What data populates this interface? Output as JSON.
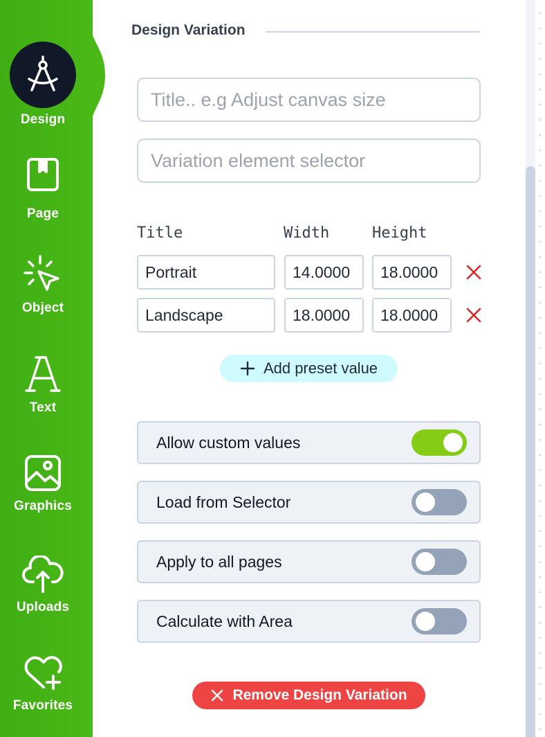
{
  "sidebar": {
    "items": [
      {
        "label": "Design",
        "icon": "compass-icon"
      },
      {
        "label": "Page",
        "icon": "bookmark-page-icon"
      },
      {
        "label": "Object",
        "icon": "cursor-click-icon"
      },
      {
        "label": "Text",
        "icon": "letter-a-icon"
      },
      {
        "label": "Graphics",
        "icon": "image-icon"
      },
      {
        "label": "Uploads",
        "icon": "cloud-upload-icon"
      },
      {
        "label": "Favorites",
        "icon": "heart-plus-icon"
      }
    ],
    "active": "Design",
    "color": "#4ab816"
  },
  "section": {
    "title": "Design Variation"
  },
  "inputs": {
    "title_placeholder": "Title.. e.g Adjust canvas size",
    "selector_placeholder": "Variation element selector"
  },
  "presets": {
    "headers": {
      "title": "Title",
      "width": "Width",
      "height": "Height"
    },
    "rows": [
      {
        "title": "Portrait",
        "width": "14.0000",
        "height": "18.0000"
      },
      {
        "title": "Landscape",
        "width": "18.0000",
        "height": "18.0000"
      }
    ],
    "add_label": "Add preset value"
  },
  "toggles": [
    {
      "label": "Allow custom values",
      "on": true
    },
    {
      "label": "Load from Selector",
      "on": false
    },
    {
      "label": "Apply to all pages",
      "on": false
    },
    {
      "label": "Calculate with Area",
      "on": false
    }
  ],
  "remove_label": "Remove Design Variation",
  "colors": {
    "toggle_on": "#84cc16",
    "toggle_off": "#94a3b8",
    "danger": "#ef4444",
    "add_bg": "#cffafe"
  }
}
